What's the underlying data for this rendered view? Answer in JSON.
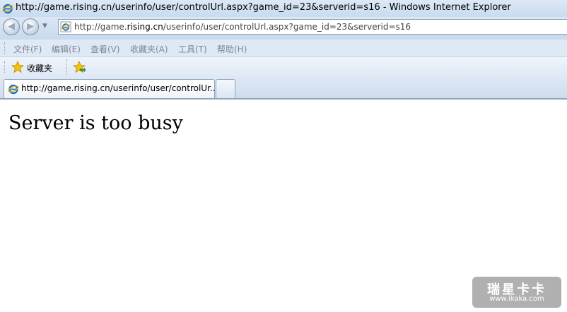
{
  "window": {
    "title": "http://game.rising.cn/userinfo/user/controlUrl.aspx?game_id=23&serverid=s16 - Windows Internet Explorer"
  },
  "address": {
    "prefix": "http://game.",
    "host": "rising.cn",
    "path": "/userinfo/user/controlUrl.aspx?game_id=23&serverid=s16"
  },
  "menu": {
    "file": "文件(F)",
    "edit": "编辑(E)",
    "view": "查看(V)",
    "favorites": "收藏夹(A)",
    "tools": "工具(T)",
    "help": "帮助(H)"
  },
  "favorites_bar": {
    "label": "收藏夹"
  },
  "tabs": [
    {
      "title": "http://game.rising.cn/userinfo/user/controlUr..."
    }
  ],
  "content": {
    "message": "Server is too busy"
  },
  "watermark": {
    "logo": "瑞星卡卡",
    "url": "www.ikaka.com"
  },
  "colors": {
    "chrome_light": "#dfe9f5",
    "ie_blue": "#1e72c8",
    "star_gold": "#f5c400"
  }
}
